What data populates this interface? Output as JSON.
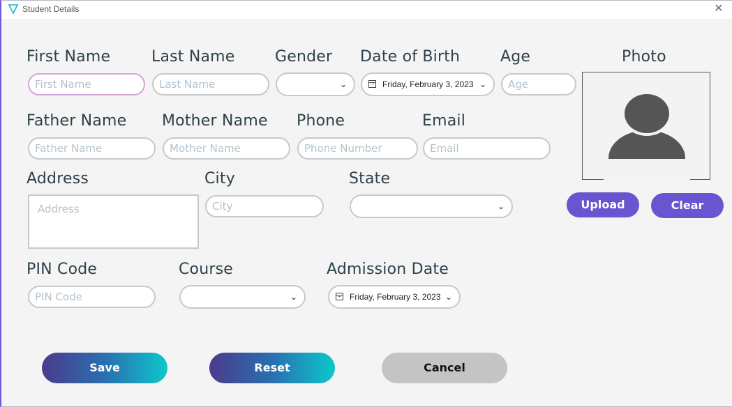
{
  "window": {
    "title": "Student Details",
    "close_glyph": "✕"
  },
  "labels": {
    "first_name": "First Name",
    "last_name": "Last Name",
    "gender": "Gender",
    "dob": "Date of Birth",
    "age": "Age",
    "photo": "Photo",
    "father_name": "Father Name",
    "mother_name": "Mother Name",
    "phone": "Phone",
    "email": "Email",
    "address": "Address",
    "city": "City",
    "state": "State",
    "pin": "PIN Code",
    "course": "Course",
    "admission_date": "Admission Date"
  },
  "placeholders": {
    "first_name": "First Name",
    "last_name": "Last Name",
    "age": "Age",
    "father_name": "Father Name",
    "mother_name": "Mother Name",
    "phone": "Phone Number",
    "email": "Email",
    "address": "Address",
    "city": "City",
    "pin": "PIN Code"
  },
  "values": {
    "gender": "",
    "state": "",
    "course": "",
    "dob": "Friday, February 3, 2023",
    "admission_date": "Friday, February 3, 2023"
  },
  "buttons": {
    "upload": "Upload",
    "clear": "Clear",
    "save": "Save",
    "reset": "Reset",
    "cancel": "Cancel"
  },
  "icons": {
    "app": "triangle-logo-icon",
    "photo": "user-avatar-icon",
    "calendar": "calendar-icon",
    "dropdown": "chevron-down-icon"
  },
  "colors": {
    "accent": "#6a55d0",
    "label": "#2e4049",
    "placeholder": "#b3c2cc",
    "gradient_start": "#4a3b8c",
    "gradient_end": "#0bc8cc"
  }
}
